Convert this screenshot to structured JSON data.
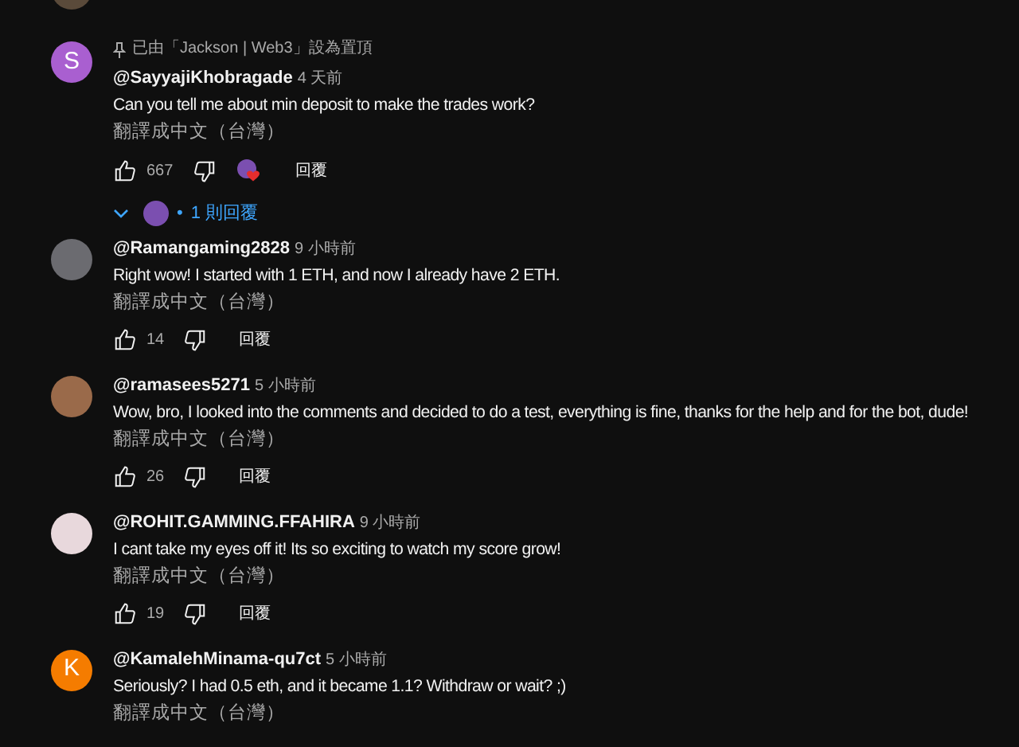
{
  "comments": [
    {
      "avatar": {
        "kind": "photo",
        "color": "#5a4a3a"
      },
      "cut": true
    },
    {
      "pinned": "已由「Jackson | Web3」設為置頂",
      "avatar": {
        "kind": "letter",
        "letter": "S",
        "color": "#a95fd0"
      },
      "username": "@SayyajiKhobragade",
      "time": "4 天前",
      "text": "Can you tell me about min deposit to make the trades work?",
      "translate": "翻譯成中文（台灣）",
      "likes": "667",
      "creator_heart": true,
      "reply": "回覆",
      "replies_separator": "•",
      "replies": "1 則回覆"
    },
    {
      "avatar": {
        "kind": "photo",
        "color": "#6b6b70"
      },
      "username": "@Ramangaming2828",
      "time": "9 小時前",
      "text": "Right wow! I started with 1 ETH, and now I already have 2 ETH.",
      "translate": "翻譯成中文（台灣）",
      "likes": "14",
      "creator_heart": false,
      "reply": "回覆"
    },
    {
      "avatar": {
        "kind": "photo",
        "color": "#9a6a4a"
      },
      "username": "@ramasees5271",
      "time": "5 小時前",
      "text": "Wow, bro, I looked into the comments and decided to do a test, everything is fine, thanks for the help and for the bot, dude!",
      "translate": "翻譯成中文（台灣）",
      "likes": "26",
      "creator_heart": false,
      "reply": "回覆"
    },
    {
      "avatar": {
        "kind": "photo",
        "color": "#e8d8dc"
      },
      "username": "@ROHIT.GAMMING.FFAHIRA",
      "time": "9 小時前",
      "text": "I cant take my eyes off it! Its so exciting to watch my score grow!",
      "translate": "翻譯成中文（台灣）",
      "likes": "19",
      "creator_heart": false,
      "reply": "回覆"
    },
    {
      "avatar": {
        "kind": "letter",
        "letter": "K",
        "color": "#f57c00"
      },
      "username": "@KamalehMinama-qu7ct",
      "time": "5 小時前",
      "text": "Seriously? I had 0.5 eth, and it became 1.1? Withdraw or wait? ;)",
      "translate": "翻譯成中文（台灣）"
    }
  ]
}
